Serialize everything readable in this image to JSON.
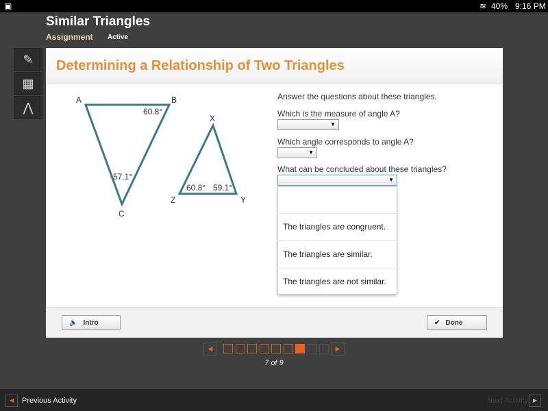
{
  "status": {
    "battery": "40%",
    "time": "9:16 PM"
  },
  "header": {
    "title": "Similar Triangles",
    "assignment": "Assignment",
    "state": "Active"
  },
  "tools": [
    {
      "icon": "pencil-icon"
    },
    {
      "icon": "calculator-icon"
    },
    {
      "icon": "reference-icon"
    }
  ],
  "activity": {
    "title": "Determining a Relationship of Two Triangles",
    "figure": {
      "vertices": [
        "A",
        "B",
        "C",
        "X",
        "Y",
        "Z"
      ],
      "angle_B": "60.8°",
      "angle_C": "57.1°",
      "angle_Z": "60.8°",
      "angle_Y": "59.1°"
    },
    "instructions": "Answer the questions about these triangles.",
    "q1": "Which is the measure of angle A?",
    "q2": "Which angle corresponds to angle A?",
    "q3": "What can be concluded about these triangles?",
    "options": [
      "",
      "The triangles are congruent.",
      "The triangles are similar.",
      "The triangles are not similar."
    ],
    "intro": "Intro",
    "done": "Done"
  },
  "pager": {
    "label": "7 of 9",
    "current": 7,
    "total": 9,
    "accent": "#e8641e"
  },
  "bottom": {
    "prev": "Previous Activity",
    "next": "Next Activity"
  }
}
